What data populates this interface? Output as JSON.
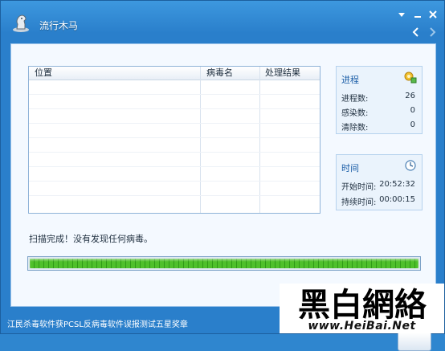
{
  "window": {
    "title": "流行木马"
  },
  "table": {
    "columns": [
      "位置",
      "病毒名",
      "处理结果"
    ],
    "rows": []
  },
  "process": {
    "title": "进程",
    "icon": "gear-puzzle-icon",
    "items": [
      {
        "label": "进程数:",
        "value": "26"
      },
      {
        "label": "感染数:",
        "value": "0"
      },
      {
        "label": "清除数:",
        "value": "0"
      }
    ]
  },
  "time": {
    "title": "时间",
    "icon": "clock-icon",
    "items": [
      {
        "label": "开始时间:",
        "value": "20:52:32"
      },
      {
        "label": "持续时间:",
        "value": "00:00:15"
      }
    ]
  },
  "status_text": "扫描完成！没有发现任何病毒。",
  "progress": {
    "percent": 100,
    "color": "#3fb31f"
  },
  "footer_text": "江民杀毒软件获PCSL反病毒软件误报测试五星奖章",
  "watermark": {
    "logo_text": "黑白網絡",
    "url": "www.HeiBai.Net"
  },
  "colors": {
    "titlebar": "#2a7fcb",
    "panel": "#f4f9ff",
    "accent": "#1d5fa8"
  }
}
